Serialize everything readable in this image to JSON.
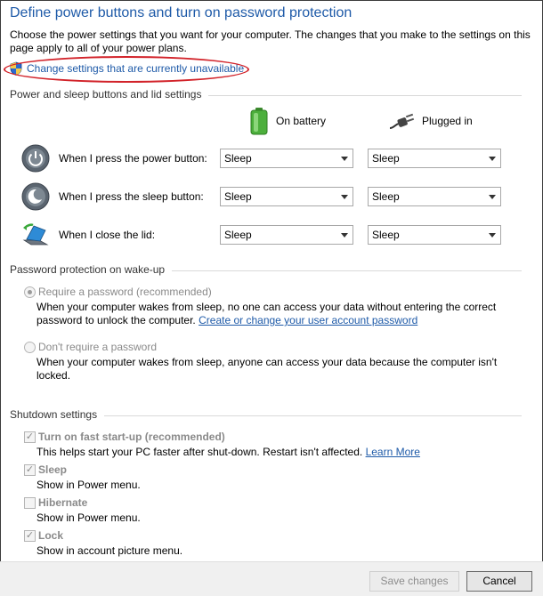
{
  "header": {
    "title": "Define power buttons and turn on password protection",
    "intro": "Choose the power settings that you want for your computer. The changes that you make to the settings on this page apply to all of your power plans.",
    "change_link": "Change settings that are currently unavailable"
  },
  "power_section": {
    "heading": "Power and sleep buttons and lid settings",
    "columns": {
      "battery": "On battery",
      "plugged": "Plugged in"
    },
    "rows": [
      {
        "label": "When I press the power button:",
        "battery": "Sleep",
        "plugged": "Sleep",
        "icon": "power-button-icon"
      },
      {
        "label": "When I press the sleep button:",
        "battery": "Sleep",
        "plugged": "Sleep",
        "icon": "sleep-button-icon"
      },
      {
        "label": "When I close the lid:",
        "battery": "Sleep",
        "plugged": "Sleep",
        "icon": "laptop-lid-icon"
      }
    ]
  },
  "password_section": {
    "heading": "Password protection on wake-up",
    "require_label": "Require a password (recommended)",
    "require_desc": "When your computer wakes from sleep, no one can access your data without entering the correct password to unlock the computer.",
    "require_link": "Create or change your user account password",
    "norequire_label": "Don't require a password",
    "norequire_desc": "When your computer wakes from sleep, anyone can access your data because the computer isn't locked."
  },
  "shutdown_section": {
    "heading": "Shutdown settings",
    "fast_startup_label": "Turn on fast start-up (recommended)",
    "fast_startup_desc": "This helps start your PC faster after shut-down. Restart isn't affected.",
    "fast_startup_link": "Learn More",
    "sleep_label": "Sleep",
    "sleep_desc": "Show in Power menu.",
    "hibernate_label": "Hibernate",
    "hibernate_desc": "Show in Power menu.",
    "lock_label": "Lock",
    "lock_desc": "Show in account picture menu."
  },
  "footer": {
    "save_label": "Save changes",
    "cancel_label": "Cancel"
  },
  "colors": {
    "link": "#1e5aa8",
    "highlight_circle": "#d2232a",
    "disabled_text": "#8a8a8a"
  }
}
